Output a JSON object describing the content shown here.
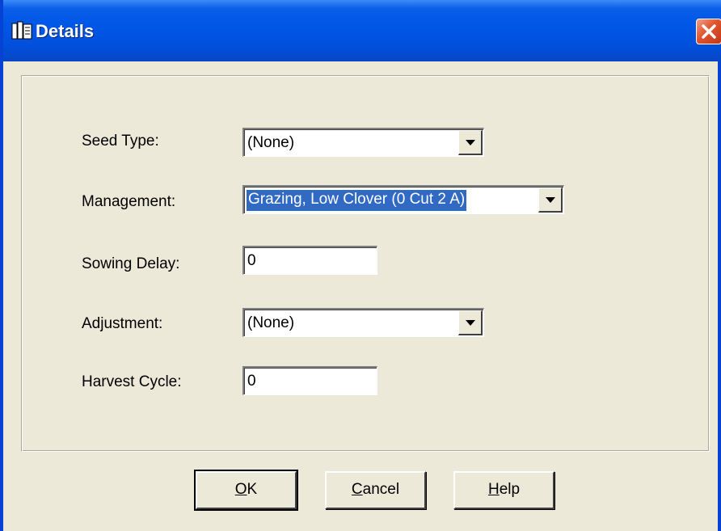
{
  "window": {
    "title": "Details",
    "close_label": "Close"
  },
  "fields": [
    {
      "label": "Seed Type:",
      "kind": "combo",
      "value": "(None)"
    },
    {
      "label": "Management:",
      "kind": "combo",
      "value": "Grazing, Low Clover (0 Cut 2 A)",
      "selected": true
    },
    {
      "label": "Sowing Delay:",
      "kind": "text",
      "value": "0"
    },
    {
      "label": "Adjustment:",
      "kind": "combo",
      "value": "(None)"
    },
    {
      "label": "Harvest Cycle:",
      "kind": "text",
      "value": "0"
    }
  ],
  "buttons": {
    "ok": {
      "accel": "O",
      "rest": "K"
    },
    "cancel": {
      "accel": "C",
      "rest": "ancel"
    },
    "help": {
      "accel": "H",
      "rest": "elp"
    }
  },
  "colors": {
    "titlebar": "#0057e6",
    "dialog_bg": "#ece9d8",
    "selection": "#316ac5",
    "close": "#e0542e"
  },
  "icons": [
    "dialog-icon",
    "close-icon",
    "dropdown-arrow-icon"
  ]
}
